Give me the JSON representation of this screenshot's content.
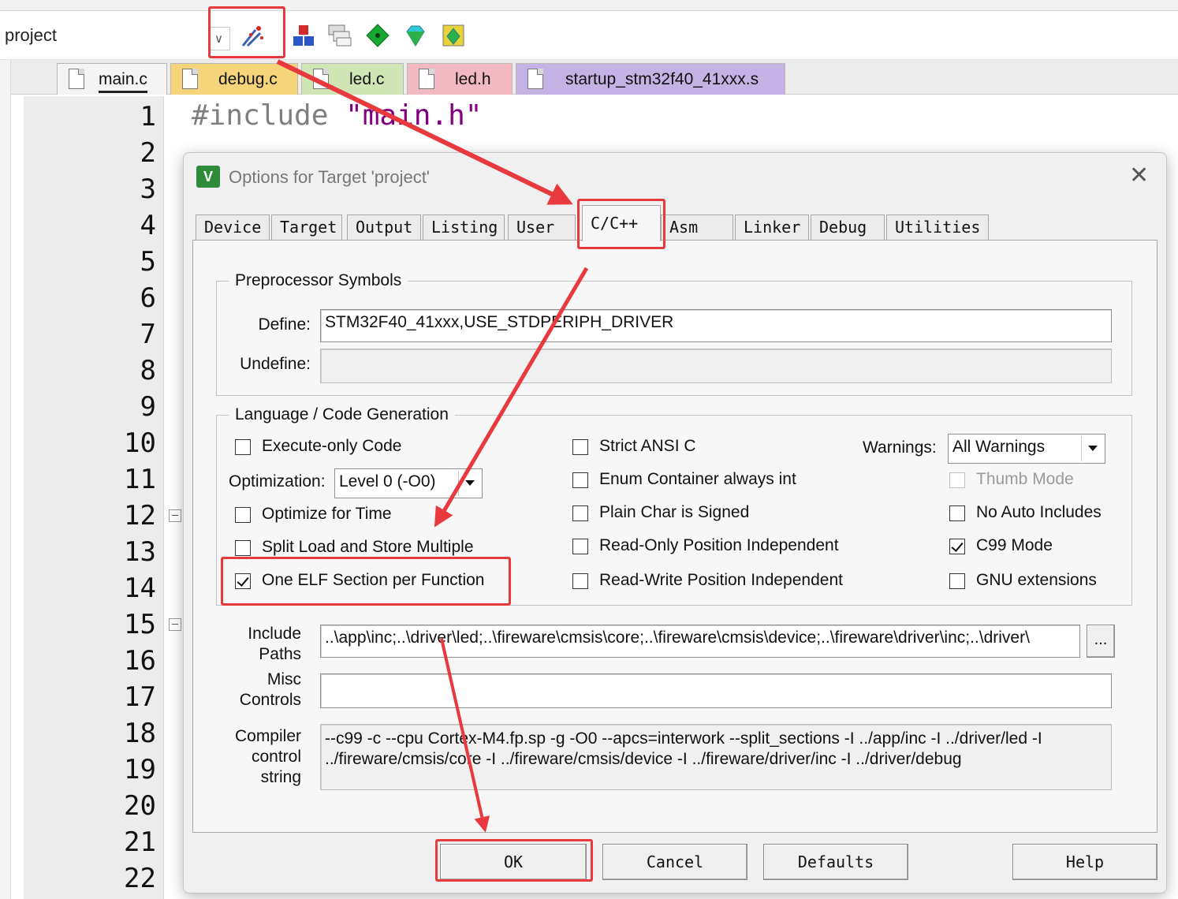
{
  "toolbar": {
    "project_name": "project",
    "icons": [
      "manage-project-icon",
      "cube-stack-icon",
      "window-stack-icon",
      "green-diamond-icon",
      "gem-icon",
      "multi-gem-icon"
    ]
  },
  "file_tabs": [
    {
      "label": "main.c",
      "active": true
    },
    {
      "label": "debug.c"
    },
    {
      "label": "led.c"
    },
    {
      "label": "led.h"
    },
    {
      "label": "startup_stm32f40_41xxx.s"
    }
  ],
  "editor": {
    "line_numbers": [
      "1",
      "2",
      "3",
      "4",
      "5",
      "6",
      "7",
      "8",
      "9",
      "10",
      "11",
      "12",
      "13",
      "14",
      "15",
      "16",
      "17",
      "18",
      "19",
      "20",
      "21",
      "22"
    ],
    "code_line1_directive": "#include",
    "code_line1_string": "\"main.h\""
  },
  "dialog": {
    "title": "Options for Target 'project'",
    "icon_letter": "V",
    "tabs": [
      "Device",
      "Target",
      "Output",
      "Listing",
      "User",
      "C/C++",
      "Asm",
      "Linker",
      "Debug",
      "Utilities"
    ],
    "active_tab": "C/C++",
    "preprocessor": {
      "group_title": "Preprocessor Symbols",
      "define_label": "Define:",
      "define_value": "STM32F40_41xxx,USE_STDPERIPH_DRIVER",
      "undefine_label": "Undefine:",
      "undefine_value": ""
    },
    "language": {
      "group_title": "Language / Code Generation",
      "execute_only": {
        "label": "Execute-only Code",
        "checked": false
      },
      "optimization_label": "Optimization:",
      "optimization_value": "Level 0 (-O0)",
      "optimize_time": {
        "label": "Optimize for Time",
        "checked": false
      },
      "split_load": {
        "label": "Split Load and Store Multiple",
        "checked": false
      },
      "one_elf": {
        "label": "One ELF Section per Function",
        "checked": true
      },
      "strict_ansi": {
        "label": "Strict ANSI C",
        "checked": false
      },
      "enum_container": {
        "label": "Enum Container always int",
        "checked": false
      },
      "plain_char": {
        "label": "Plain Char is Signed",
        "checked": false
      },
      "ro_pos_indep": {
        "label": "Read-Only Position Independent",
        "checked": false
      },
      "rw_pos_indep": {
        "label": "Read-Write Position Independent",
        "checked": false
      },
      "warnings_label": "Warnings:",
      "warnings_value": "All Warnings",
      "thumb_mode": {
        "label": "Thumb Mode",
        "checked": false,
        "disabled": true
      },
      "no_auto_includes": {
        "label": "No Auto Includes",
        "checked": false
      },
      "c99_mode": {
        "label": "C99 Mode",
        "checked": true
      },
      "gnu_extensions": {
        "label": "GNU extensions",
        "checked": false
      }
    },
    "include_paths": {
      "label_line1": "Include",
      "label_line2": "Paths",
      "value": "..\\app\\inc;..\\driver\\led;..\\fireware\\cmsis\\core;..\\fireware\\cmsis\\device;..\\fireware\\driver\\inc;..\\driver\\",
      "browse_label": "..."
    },
    "misc_controls": {
      "label_line1": "Misc",
      "label_line2": "Controls",
      "value": ""
    },
    "compiler_string": {
      "label_line1": "Compiler",
      "label_line2": "control",
      "label_line3": "string",
      "value": "--c99 -c --cpu Cortex-M4.fp.sp -g -O0 --apcs=interwork --split_sections -I ../app/inc -I ../driver/led -I ../fireware/cmsis/core -I ../fireware/cmsis/device -I ../fireware/driver/inc -I ../driver/debug"
    },
    "buttons": {
      "ok": "OK",
      "cancel": "Cancel",
      "defaults": "Defaults",
      "help": "Help"
    }
  },
  "annotation_color": "#e8393e"
}
